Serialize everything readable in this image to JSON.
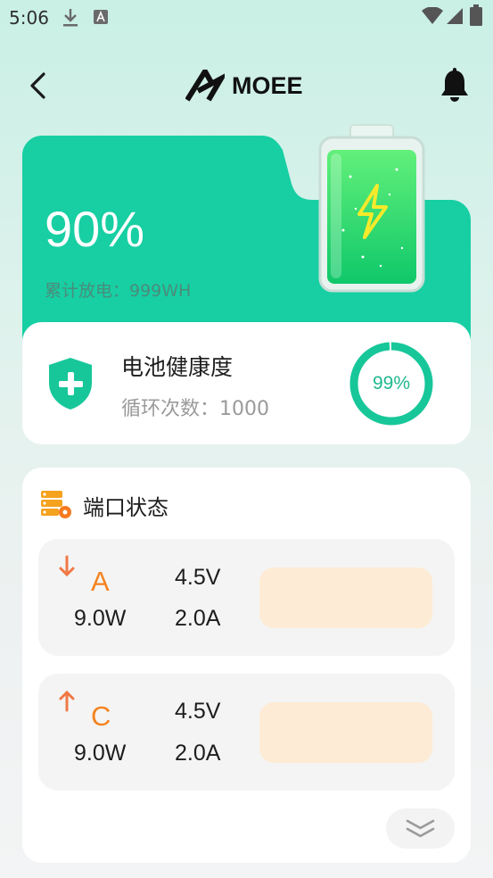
{
  "status_bar": {
    "time": "5:06",
    "icons": [
      "download-icon",
      "app-notification-icon",
      "wifi-icon",
      "cellular-signal-icon",
      "battery-icon"
    ]
  },
  "header": {
    "brand": "MOEE",
    "back_icon": "chevron-left-icon",
    "bell_icon": "bell-icon"
  },
  "battery_summary": {
    "percent": "90%",
    "cumulative_discharge": "累计放电：999WH"
  },
  "health": {
    "title": "电池健康度",
    "cycles": "循环次数：1000",
    "health_percent": "99%",
    "health_value": 99
  },
  "ports": {
    "title": "端口状态",
    "items": [
      {
        "direction": "down",
        "letter": "A",
        "watt": "9.0W",
        "volt": "4.5V",
        "amp": "2.0A"
      },
      {
        "direction": "up",
        "letter": "C",
        "watt": "9.0W",
        "volt": "4.5V",
        "amp": "2.0A"
      }
    ]
  },
  "colors": {
    "accent_green": "#17cfa3",
    "ring_green": "#1fb88f",
    "port_orange": "#f5831f",
    "arrow_orange": "#f07846",
    "bar_cream": "#fdebd5"
  }
}
